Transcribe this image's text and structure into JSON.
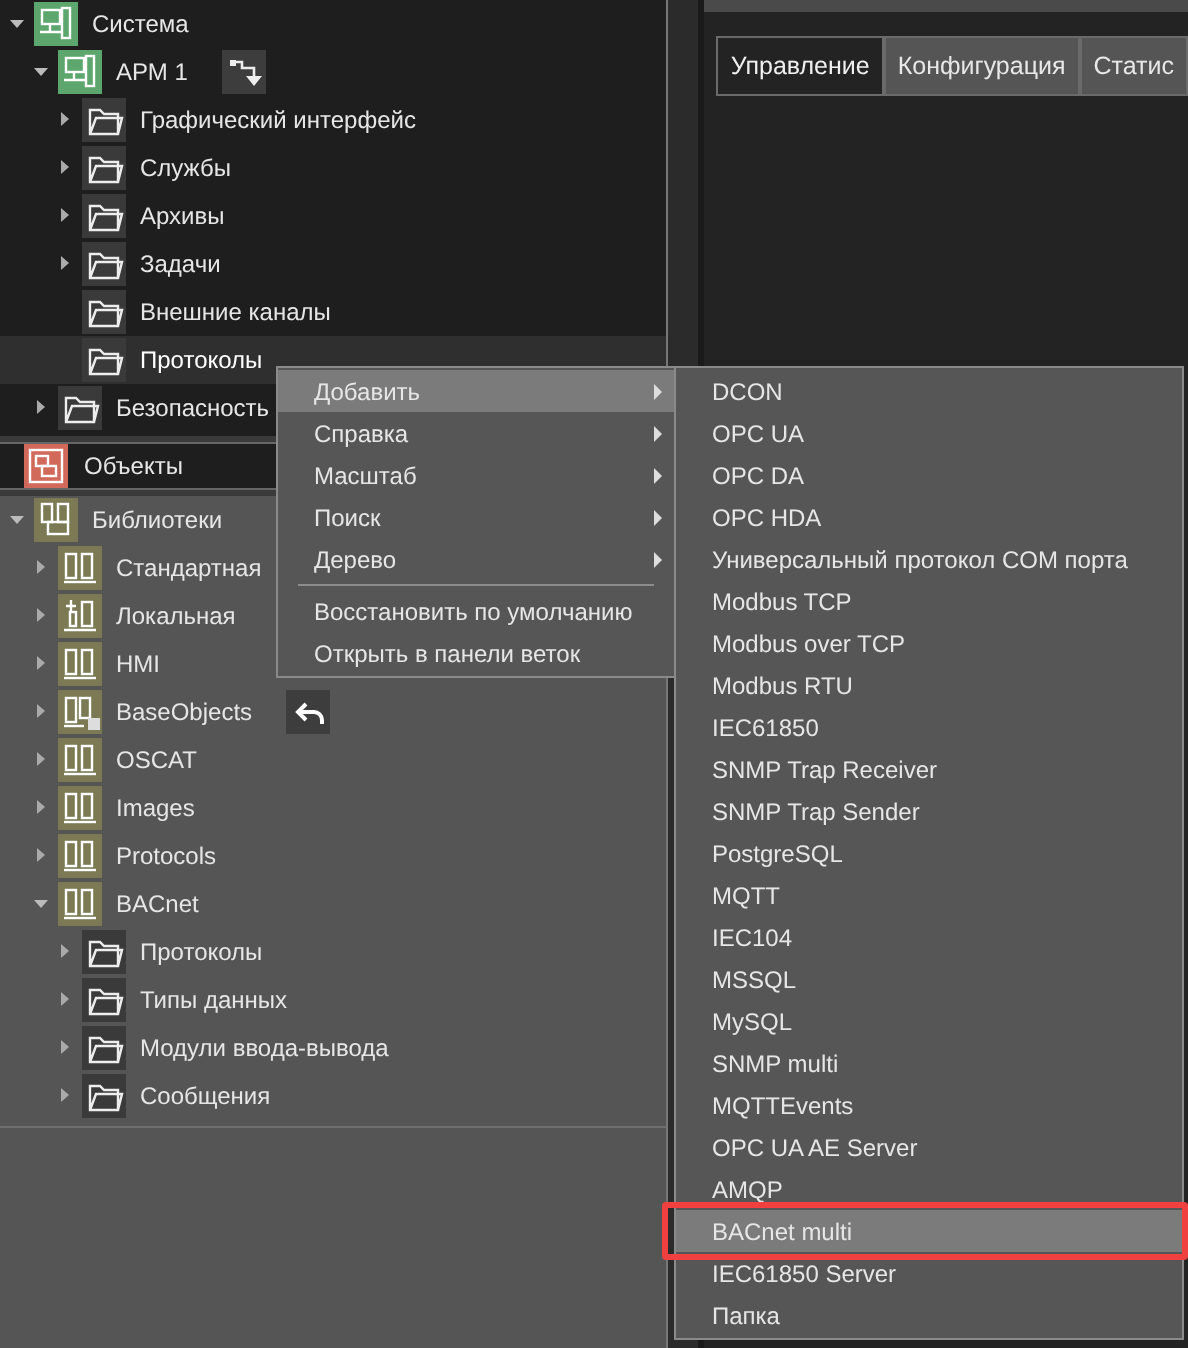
{
  "system_tree": [
    {
      "label": "Система",
      "kind": "system",
      "expanded": true,
      "selected": false,
      "children": [
        {
          "label": "АРМ 1",
          "kind": "system",
          "expanded": true,
          "selected": false,
          "tool_button": {
            "kind": "branch"
          },
          "children": [
            {
              "label": "Графический интерфейс",
              "kind": "folder",
              "expanded": false,
              "selected": false
            },
            {
              "label": "Службы",
              "kind": "folder",
              "expanded": false,
              "selected": false
            },
            {
              "label": "Архивы",
              "kind": "folder",
              "expanded": false,
              "selected": false
            },
            {
              "label": "Задачи",
              "kind": "folder",
              "expanded": false,
              "selected": false
            },
            {
              "label": "Внешние каналы",
              "kind": "folder",
              "selected": false
            },
            {
              "label": "Протоколы",
              "kind": "folder",
              "selected": true
            }
          ]
        },
        {
          "label": "Безопасность",
          "kind": "folder",
          "expanded": false,
          "selected": false
        }
      ]
    }
  ],
  "objects_row": {
    "label": "Объекты",
    "kind": "objects"
  },
  "library_tree": [
    {
      "label": "Библиотеки",
      "kind": "libraries",
      "expanded": true,
      "selected": false,
      "children": [
        {
          "label": "Стандартная",
          "kind": "library",
          "expanded": false,
          "selected": false
        },
        {
          "label": "Локальная",
          "kind": "local",
          "expanded": false,
          "selected": false
        },
        {
          "label": "HMI",
          "kind": "library",
          "expanded": false,
          "selected": false
        },
        {
          "label": "BaseObjects",
          "kind": "base",
          "expanded": false,
          "selected": false,
          "tool_button": {
            "kind": "undo"
          }
        },
        {
          "label": "OSCAT",
          "kind": "library",
          "expanded": false,
          "selected": false
        },
        {
          "label": "Images",
          "kind": "library",
          "expanded": false,
          "selected": false
        },
        {
          "label": "Protocols",
          "kind": "library",
          "expanded": false,
          "selected": false
        },
        {
          "label": "BACnet",
          "kind": "library",
          "expanded": true,
          "selected": false,
          "children": [
            {
              "label": "Протоколы",
              "kind": "folder",
              "expanded": false,
              "selected": false
            },
            {
              "label": "Типы данных",
              "kind": "folder",
              "expanded": false,
              "selected": false
            },
            {
              "label": "Модули ввода-вывода",
              "kind": "folder",
              "expanded": false,
              "selected": false
            },
            {
              "label": "Сообщения",
              "kind": "folder",
              "expanded": false,
              "selected": false
            }
          ]
        }
      ]
    }
  ],
  "tabs": [
    {
      "label": "Управление",
      "selected": true
    },
    {
      "label": "Конфигурация",
      "selected": false
    },
    {
      "label": "Статис",
      "selected": false
    }
  ],
  "context_menu": {
    "groups": [
      [
        {
          "label": "Добавить",
          "kind": "submenu",
          "selected": true
        },
        {
          "label": "Справка",
          "kind": "submenu",
          "selected": false
        },
        {
          "label": "Масштаб",
          "kind": "submenu",
          "selected": false
        },
        {
          "label": "Поиск",
          "kind": "submenu",
          "selected": false
        },
        {
          "label": "Дерево",
          "kind": "submenu",
          "selected": false
        }
      ],
      [
        {
          "label": "Восстановить по умолчанию",
          "kind": "command",
          "selected": false
        },
        {
          "label": "Открыть в панели веток",
          "kind": "command",
          "selected": false
        }
      ]
    ]
  },
  "submenu": [
    {
      "label": "DCON",
      "selected": false,
      "outlined": false
    },
    {
      "label": "OPC UA",
      "selected": false,
      "outlined": false
    },
    {
      "label": "OPC DA",
      "selected": false,
      "outlined": false
    },
    {
      "label": "OPC HDA",
      "selected": false,
      "outlined": false
    },
    {
      "label": "Универсальный протокол COM порта",
      "selected": false,
      "outlined": false
    },
    {
      "label": "Modbus TCP",
      "selected": false,
      "outlined": false
    },
    {
      "label": "Modbus over TCP",
      "selected": false,
      "outlined": false
    },
    {
      "label": "Modbus RTU",
      "selected": false,
      "outlined": false
    },
    {
      "label": "IEC61850",
      "selected": false,
      "outlined": false
    },
    {
      "label": "SNMP Trap Receiver",
      "selected": false,
      "outlined": false
    },
    {
      "label": "SNMP Trap Sender",
      "selected": false,
      "outlined": false
    },
    {
      "label": "PostgreSQL",
      "selected": false,
      "outlined": false
    },
    {
      "label": "MQTT",
      "selected": false,
      "outlined": false
    },
    {
      "label": "IEC104",
      "selected": false,
      "outlined": false
    },
    {
      "label": "MSSQL",
      "selected": false,
      "outlined": false
    },
    {
      "label": "MySQL",
      "selected": false,
      "outlined": false
    },
    {
      "label": "SNMP multi",
      "selected": false,
      "outlined": false
    },
    {
      "label": "MQTTEvents",
      "selected": false,
      "outlined": false
    },
    {
      "label": "OPC UA AE Server",
      "selected": false,
      "outlined": false
    },
    {
      "label": "AMQP",
      "selected": false,
      "outlined": false
    },
    {
      "label": "BACnet multi",
      "selected": true,
      "outlined": true
    },
    {
      "label": "IEC61850 Server",
      "selected": false,
      "outlined": false
    },
    {
      "label": "Папка",
      "selected": false,
      "outlined": false
    }
  ]
}
